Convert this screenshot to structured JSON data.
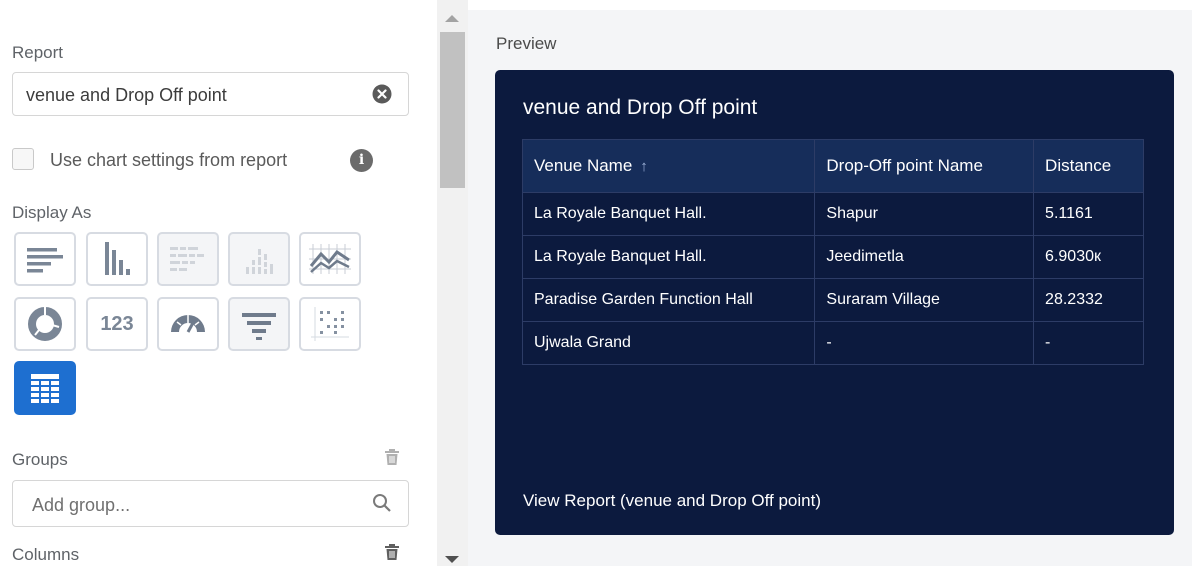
{
  "sidebar": {
    "report_label": "Report",
    "report_value": "venue and Drop Off point",
    "chart_settings_label": "Use chart settings from report",
    "display_as_label": "Display As",
    "display_types": [
      "bar-horizontal",
      "bar-vertical",
      "stacked-bar-horizontal",
      "stacked-bar-vertical",
      "line",
      "donut",
      "metric",
      "gauge",
      "funnel",
      "scatter",
      "table"
    ],
    "metric_tile_text": "123",
    "groups_label": "Groups",
    "add_group_placeholder": "Add group...",
    "columns_label": "Columns"
  },
  "preview": {
    "label": "Preview",
    "title": "venue and Drop Off point",
    "columns": [
      "Venue Name",
      "Drop-Off point Name",
      "Distance"
    ],
    "sort_indicator": "↑",
    "rows": [
      [
        "La Royale Banquet Hall.",
        "Shapur",
        "5.1161"
      ],
      [
        "La Royale Banquet Hall.",
        "Jeedimetla",
        "6.9030к"
      ],
      [
        "Paradise Garden Function Hall",
        "Suraram Village",
        "28.2332"
      ],
      [
        "Ujwala Grand",
        "-",
        "-"
      ]
    ],
    "view_report_link": "View Report (venue and Drop Off point)"
  },
  "colors": {
    "card_bg": "#0c1a3e",
    "header_bg": "#162d5a",
    "selected_tile": "#1e6fd0"
  }
}
